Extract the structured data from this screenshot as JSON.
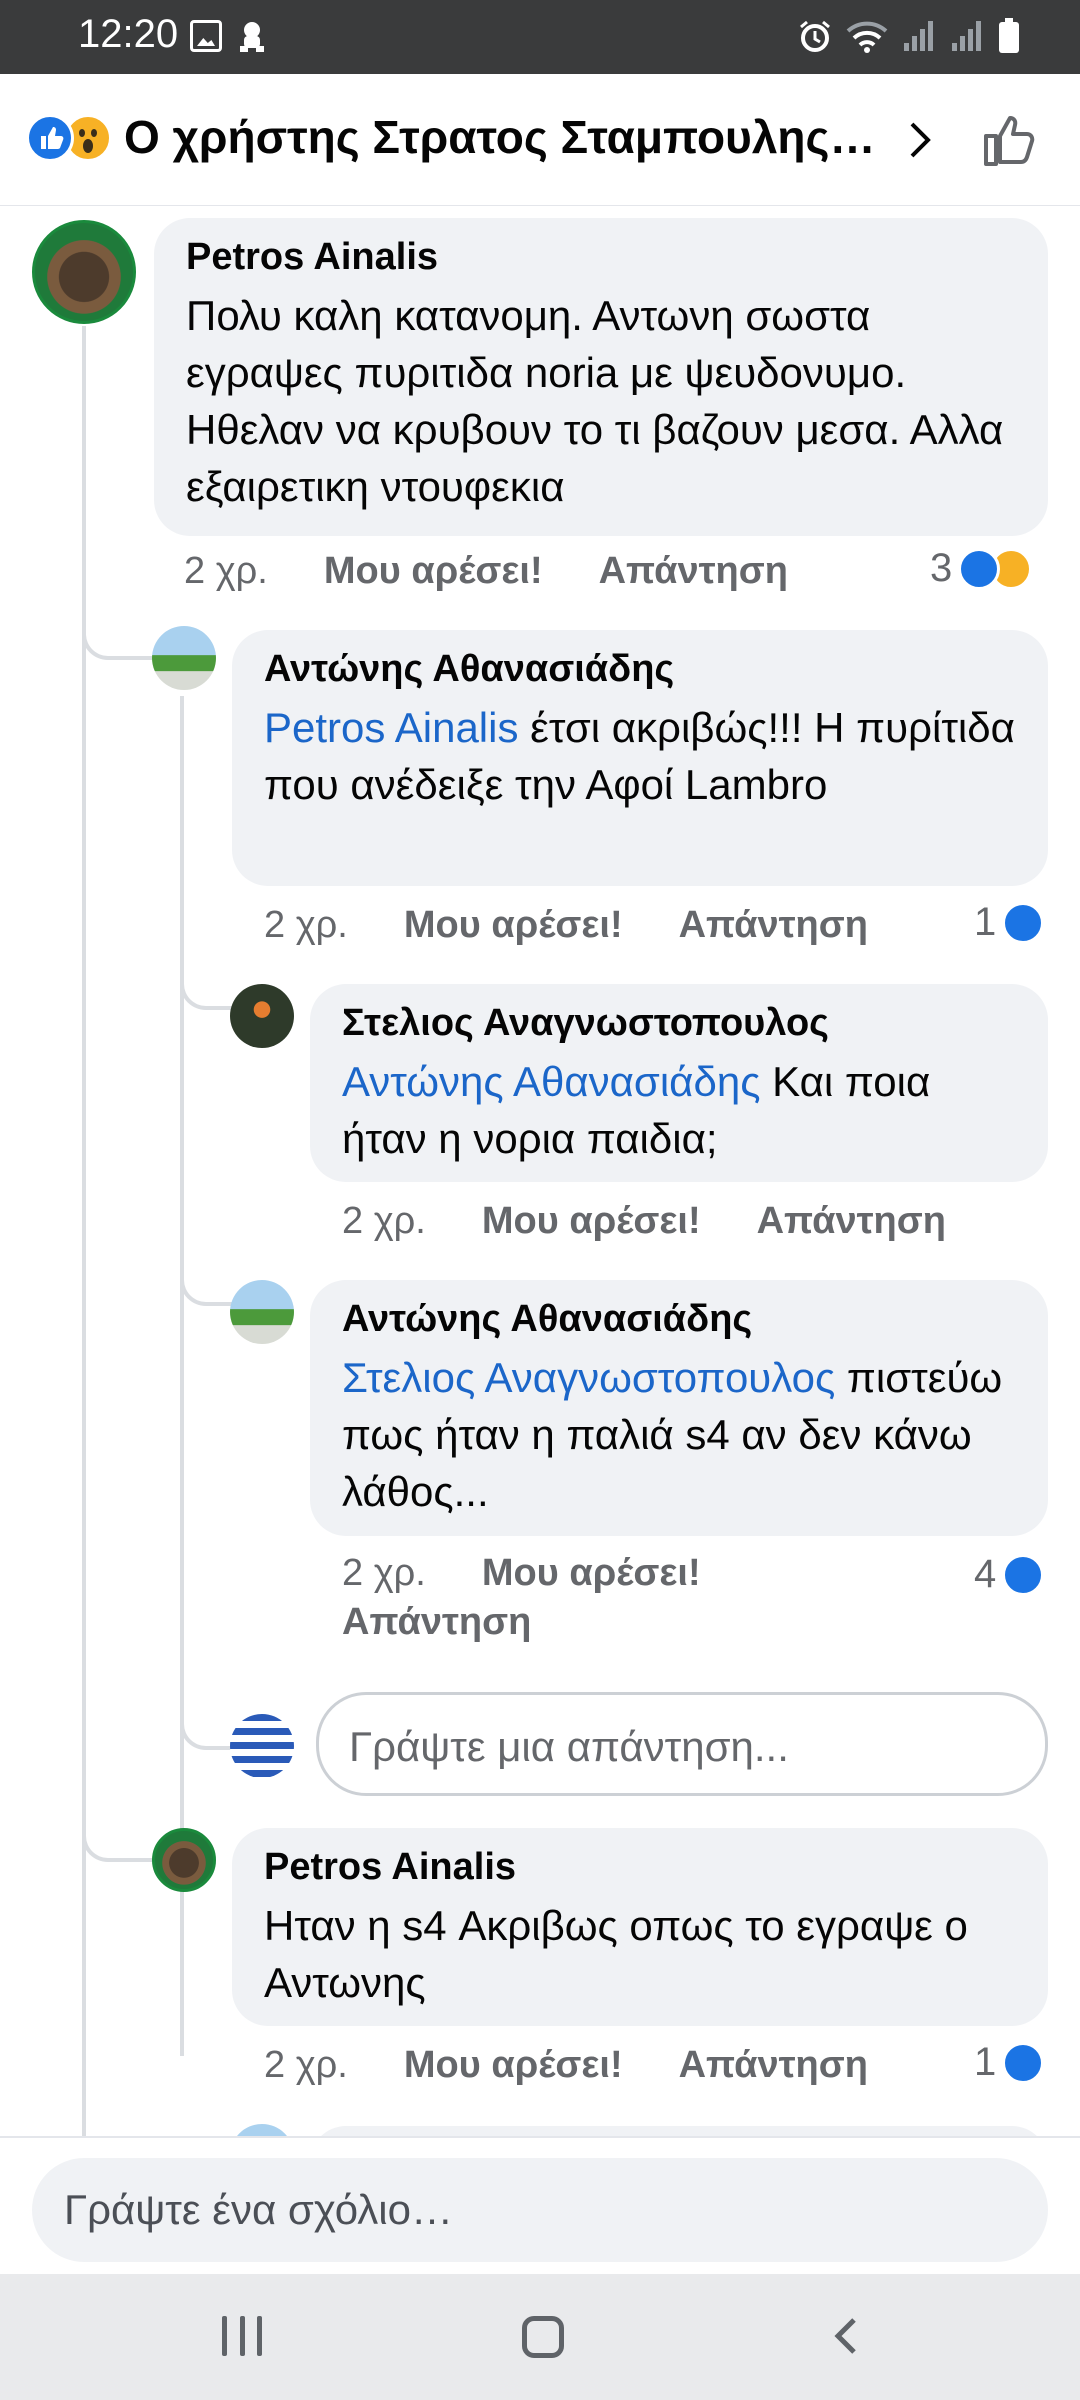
{
  "status_bar": {
    "time": "12:20"
  },
  "header": {
    "title": "Ο χρήστης Στρατος Σταμπουλης κ…",
    "reactions": [
      "like-reaction",
      "wow-reaction"
    ]
  },
  "comments": [
    {
      "author": "Petros Ainalis",
      "mention": "",
      "text": "Πολυ καλη κατανομη. Αντωνη σωστα εγραψες πυριτιδα noria με ψευδονυμο. Ηθελαν να κρυβουν το τι βαζουν μεσα. Αλλα εξαιρετικη ντουφεκια",
      "time": "2 χρ.",
      "like_label": "Μου αρέσει!",
      "reply_label": "Απάντηση",
      "reaction_count": "3"
    },
    {
      "author": "Αντώνης Αθανασιάδης",
      "mention": "Petros Ainalis",
      "text": " έτσι ακριβώς!!! Η πυρίτιδα που ανέδειξε την Αφοί Lambro",
      "time": "2 χρ.",
      "like_label": "Μου αρέσει!",
      "reply_label": "Απάντηση",
      "reaction_count": "1"
    },
    {
      "author": "Στελιος Αναγνωστοπουλος",
      "mention": "Αντώνης Αθανασιάδης",
      "text": " Και ποια ήταν η νορια παιδια;",
      "time": "2 χρ.",
      "like_label": "Μου αρέσει!",
      "reply_label": "Απάντηση",
      "reaction_count": ""
    },
    {
      "author": "Αντώνης Αθανασιάδης",
      "mention": "Στελιος Αναγνωστοπουλος",
      "text": " πιστεύω πως ήταν η παλιά s4 αν δεν κάνω λάθος...",
      "time": "2 χρ.",
      "like_label": "Μου αρέσει!",
      "reply_label": "Απάντηση",
      "reaction_count": "4"
    },
    {
      "author": "Petros Ainalis",
      "mention": "",
      "text": "Ηταν η s4 Ακριβως οπως το εγραψε ο Αντωνης",
      "time": "2 χρ.",
      "like_label": "Μου αρέσει!",
      "reply_label": "Απάντηση",
      "reaction_count": "1"
    }
  ],
  "reply_input": {
    "placeholder": "Γράψτε μια απάντηση..."
  },
  "composer": {
    "placeholder": "Γράψτε ένα σχόλιο…"
  },
  "colors": {
    "mention": "#1b66c9",
    "like_blue": "#1b74e4",
    "wow_yellow": "#f7b125",
    "bubble": "#f0f2f5"
  }
}
